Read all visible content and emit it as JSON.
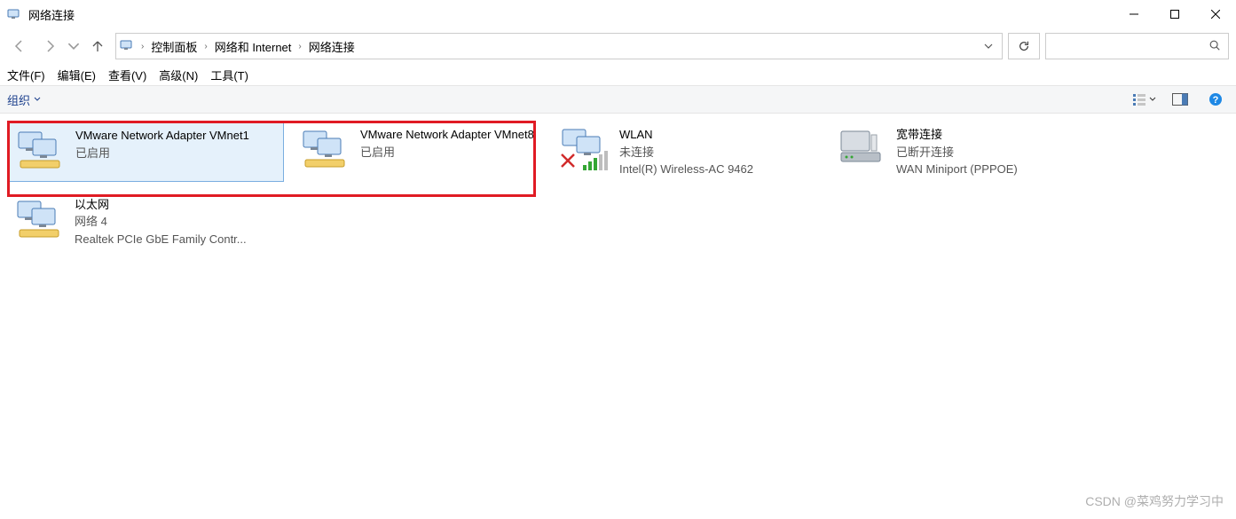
{
  "window": {
    "title": "网络连接"
  },
  "breadcrumb": {
    "item0": "控制面板",
    "item1": "网络和 Internet",
    "item2": "网络连接"
  },
  "menu": {
    "file": "文件(F)",
    "edit": "编辑(E)",
    "view": "查看(V)",
    "advanced": "高级(N)",
    "tools": "工具(T)"
  },
  "toolbar": {
    "organize": "组织"
  },
  "adapters": {
    "a0": {
      "name": "VMware Network Adapter VMnet1",
      "status": "已启用",
      "detail": ""
    },
    "a1": {
      "name": "VMware Network Adapter VMnet8",
      "status": "已启用",
      "detail": ""
    },
    "a2": {
      "name": "WLAN",
      "status": "未连接",
      "detail": "Intel(R) Wireless-AC 9462"
    },
    "a3": {
      "name": "宽带连接",
      "status": "已断开连接",
      "detail": "WAN Miniport (PPPOE)"
    },
    "a4": {
      "name": "以太网",
      "status": "网络 4",
      "detail": "Realtek PCIe GbE Family Contr..."
    }
  },
  "watermark": "CSDN @菜鸡努力学习中"
}
